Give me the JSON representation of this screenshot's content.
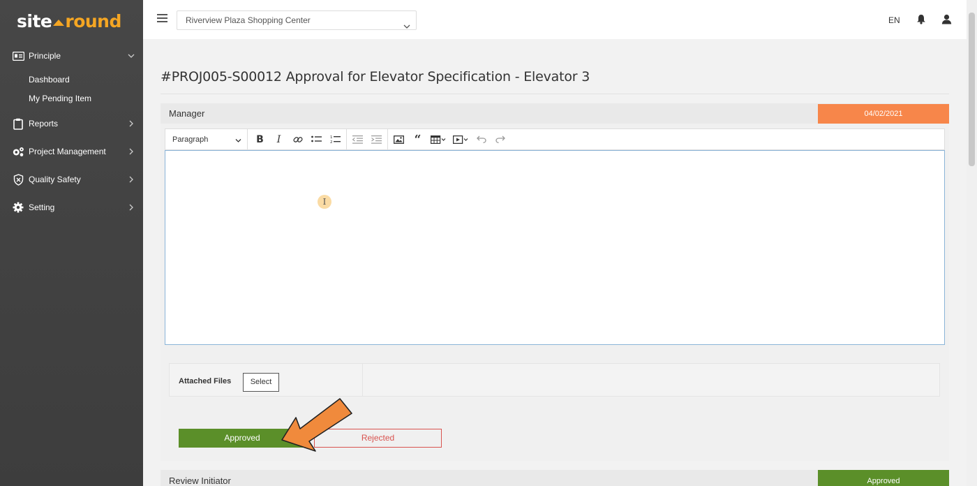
{
  "brand": {
    "left": "site",
    "right": "round"
  },
  "sidebar": {
    "items": [
      {
        "label": "Principle",
        "icon": "id-card-icon",
        "expanded": true,
        "children": [
          {
            "label": "Dashboard"
          },
          {
            "label": "My Pending Item"
          }
        ]
      },
      {
        "label": "Reports",
        "icon": "clipboard-icon"
      },
      {
        "label": "Project Management",
        "icon": "gears-icon"
      },
      {
        "label": "Quality Safety",
        "icon": "shield-icon"
      },
      {
        "label": "Setting",
        "icon": "gear-icon"
      }
    ]
  },
  "topbar": {
    "project_select": "Riverview Plaza Shopping Center",
    "language": "EN"
  },
  "page": {
    "title": "#PROJ005-S00012 Approval for Elevator Specification - Elevator 3"
  },
  "approval_panel": {
    "role": "Manager",
    "date": "04/02/2021",
    "editor": {
      "paragraph_format": "Paragraph",
      "toolbar_icons": [
        "bold-icon",
        "italic-icon",
        "link-icon",
        "bulleted-list-icon",
        "numbered-list-icon",
        "outdent-icon",
        "indent-icon",
        "image-icon",
        "quote-icon",
        "table-icon",
        "media-icon",
        "undo-icon",
        "redo-icon"
      ],
      "content": ""
    },
    "attached_files_label": "Attached Files",
    "select_button": "Select",
    "approve_button": "Approved",
    "reject_button": "Rejected"
  },
  "review_panel": {
    "role": "Review Initiator",
    "status": "Approved"
  },
  "colors": {
    "sidebar_bg": "#444444",
    "brand_accent": "#f5a623",
    "date_badge": "#f7864a",
    "approve_green": "#5b8f29",
    "reject_red": "#d9534f",
    "annotation_arrow": "#f08a3c"
  }
}
